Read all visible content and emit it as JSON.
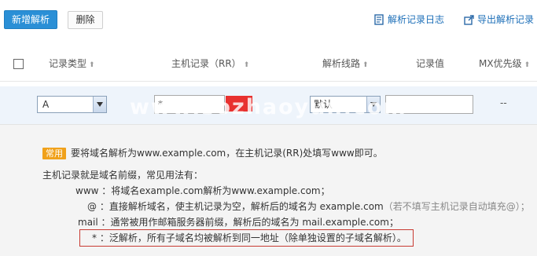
{
  "toolbar": {
    "add_label": "新增解析",
    "delete_label": "删除",
    "log_label": "解析记录日志",
    "export_label": "导出解析记录"
  },
  "table": {
    "headers": {
      "record_type": "记录类型",
      "host": "主机记录（RR）",
      "line": "解析线路",
      "value": "记录值",
      "mx": "MX优先级"
    },
    "sort_arrow": "⬆"
  },
  "edit_row": {
    "record_type": "A",
    "host_value": "*",
    "line_value": "默认",
    "record_value": "",
    "mx_value": "--"
  },
  "watermark": "www.sozhaoyun.com",
  "tips": {
    "badge": "常用",
    "common_text": "要将域名解析为www.example.com，在主机记录(RR)处填写www即可。",
    "intro": "主机记录就是域名前缀，常见用法有：",
    "items": [
      {
        "key": "www ：",
        "desc": "将域名example.com解析为www.example.com；",
        "note": ""
      },
      {
        "key": "@ ：",
        "desc": "直接解析域名，使主机记录为空，解析后的域名为 example.com",
        "note": "（若不填写主机记录自动填充@）；"
      },
      {
        "key": "mail ：",
        "desc": "通常被用作邮箱服务器前缀，解析后的域名为 mail.example.com；",
        "note": ""
      },
      {
        "key": "* ：",
        "desc": "泛解析，所有子域名均被解析到同一地址（除单独设置的子域名解析）。",
        "note": ""
      }
    ]
  },
  "colors": {
    "primary": "#2a8fd6",
    "link": "#1d6fb8",
    "badge": "#f0a11a",
    "highlight_border": "#c83a32",
    "edit_row_bg": "#eef4fb"
  }
}
